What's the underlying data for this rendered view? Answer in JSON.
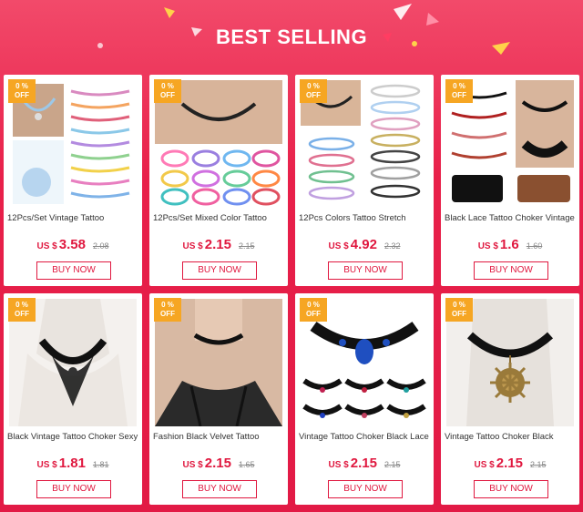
{
  "header": {
    "title": "BEST SELLING"
  },
  "products": [
    {
      "badge_top": "0 %",
      "badge_bottom": "OFF",
      "name": "12Pcs/Set Vintage Tattoo",
      "currency": "US $",
      "price": "3.58",
      "old_price": "2.08",
      "buy_label": "BUY NOW",
      "image_icon": "choker-set-image"
    },
    {
      "badge_top": "0 %",
      "badge_bottom": "OFF",
      "name": "12Pcs/Set Mixed Color Tattoo",
      "currency": "US $",
      "price": "2.15",
      "old_price": "2.15",
      "buy_label": "BUY NOW",
      "image_icon": "mixed-color-chokers-image"
    },
    {
      "badge_top": "0 %",
      "badge_bottom": "OFF",
      "name": "12Pcs Colors Tattoo Stretch",
      "currency": "US $",
      "price": "4.92",
      "old_price": "2.32",
      "buy_label": "BUY NOW",
      "image_icon": "stretch-chokers-image"
    },
    {
      "badge_top": "0 %",
      "badge_bottom": "OFF",
      "name": "Black Lace Tattoo Choker Vintage",
      "currency": "US $",
      "price": "1.6",
      "old_price": "1.60",
      "buy_label": "BUY NOW",
      "image_icon": "heart-lace-chokers-image"
    },
    {
      "badge_top": "0 %",
      "badge_bottom": "OFF",
      "name": "Black Vintage Tattoo Choker Sexy",
      "currency": "US $",
      "price": "1.81",
      "old_price": "1.81",
      "buy_label": "BUY NOW",
      "image_icon": "lace-necklace-image"
    },
    {
      "badge_top": "0 %",
      "badge_bottom": "OFF",
      "name": "Fashion Black Velvet Tattoo",
      "currency": "US $",
      "price": "2.15",
      "old_price": "1.65",
      "buy_label": "BUY NOW",
      "image_icon": "velvet-choker-image"
    },
    {
      "badge_top": "0 %",
      "badge_bottom": "OFF",
      "name": "Vintage Tattoo Choker Black Lace",
      "currency": "US $",
      "price": "2.15",
      "old_price": "2.15",
      "buy_label": "BUY NOW",
      "image_icon": "gem-lace-chokers-image"
    },
    {
      "badge_top": "0 %",
      "badge_bottom": "OFF",
      "name": "Vintage Tattoo Choker Black",
      "currency": "US $",
      "price": "2.15",
      "old_price": "2.15",
      "buy_label": "BUY NOW",
      "image_icon": "sun-pendant-choker-image"
    }
  ],
  "colors": {
    "background": "#e8204a",
    "accent": "#e0183f",
    "badge": "#f6a623"
  }
}
